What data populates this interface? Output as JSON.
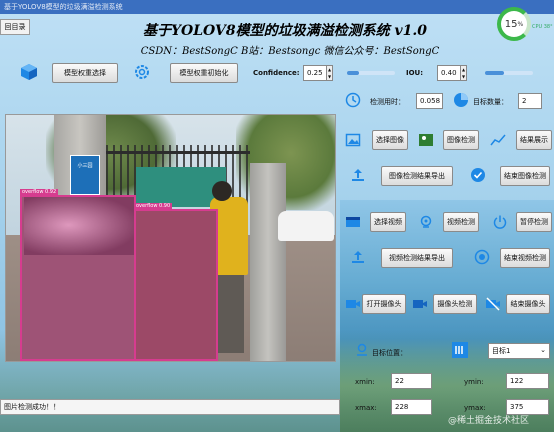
{
  "window": {
    "title": "基于YOLOV8模型的垃圾满溢检测系统"
  },
  "menu": {
    "back_label": "回目录"
  },
  "perf": {
    "score": "15",
    "score_unit": "%",
    "cpu": "CPU 38°"
  },
  "header": {
    "title": "基于YOLOV8模型的垃圾满溢检测系统 v1.0",
    "subtitle": "CSDN：BestSongC   B站：Bestsongc   微信公众号：BestSongC"
  },
  "toolbar": {
    "select_model_label": "模型权重选择",
    "init_model_label": "模型权重初始化",
    "confidence_label": "Confidence:",
    "confidence_value": "0.25",
    "confidence_level": 0.25,
    "iou_label": "IOU:",
    "iou_value": "0.40",
    "iou_level": 0.4
  },
  "metrics": {
    "time_label": "检测用时：",
    "time_value": "0.058",
    "count_label": "目标数量：",
    "count_value": "2"
  },
  "image_controls": {
    "select_image": "选择图像",
    "detect_image": "图像检测",
    "show_result": "结果展示",
    "export_image_result": "图像检测结果导出",
    "end_image_detect": "结束图像检测"
  },
  "video_controls": {
    "select_video": "选择视频",
    "detect_video": "视频检测",
    "pause_detect": "暂停检测",
    "export_video_result": "视频检测结果导出",
    "end_video_detect": "结束视频检测"
  },
  "camera_controls": {
    "open_camera": "打开摄像头",
    "detect_camera": "摄像头检测",
    "end_camera": "结束摄像头"
  },
  "target": {
    "position_label": "目标位置：",
    "selected_target": "目标1",
    "xmin_label": "xmin:",
    "xmin_value": "22",
    "ymin_label": "ymin:",
    "ymin_value": "122",
    "xmax_label": "xmax:",
    "xmax_value": "228",
    "ymax_label": "ymax:",
    "ymax_value": "375"
  },
  "detections": [
    {
      "label": "overflow 0.92"
    },
    {
      "label": "overflow 0.90"
    }
  ],
  "image": {
    "sign_text": "小三园"
  },
  "status": {
    "message": "图片检测成功！！"
  },
  "watermark": "@稀土掘金技术社区",
  "colors": {
    "accent": "#4a90d9",
    "detection": "#d63c8f",
    "score_ring": "#3cb84a"
  }
}
